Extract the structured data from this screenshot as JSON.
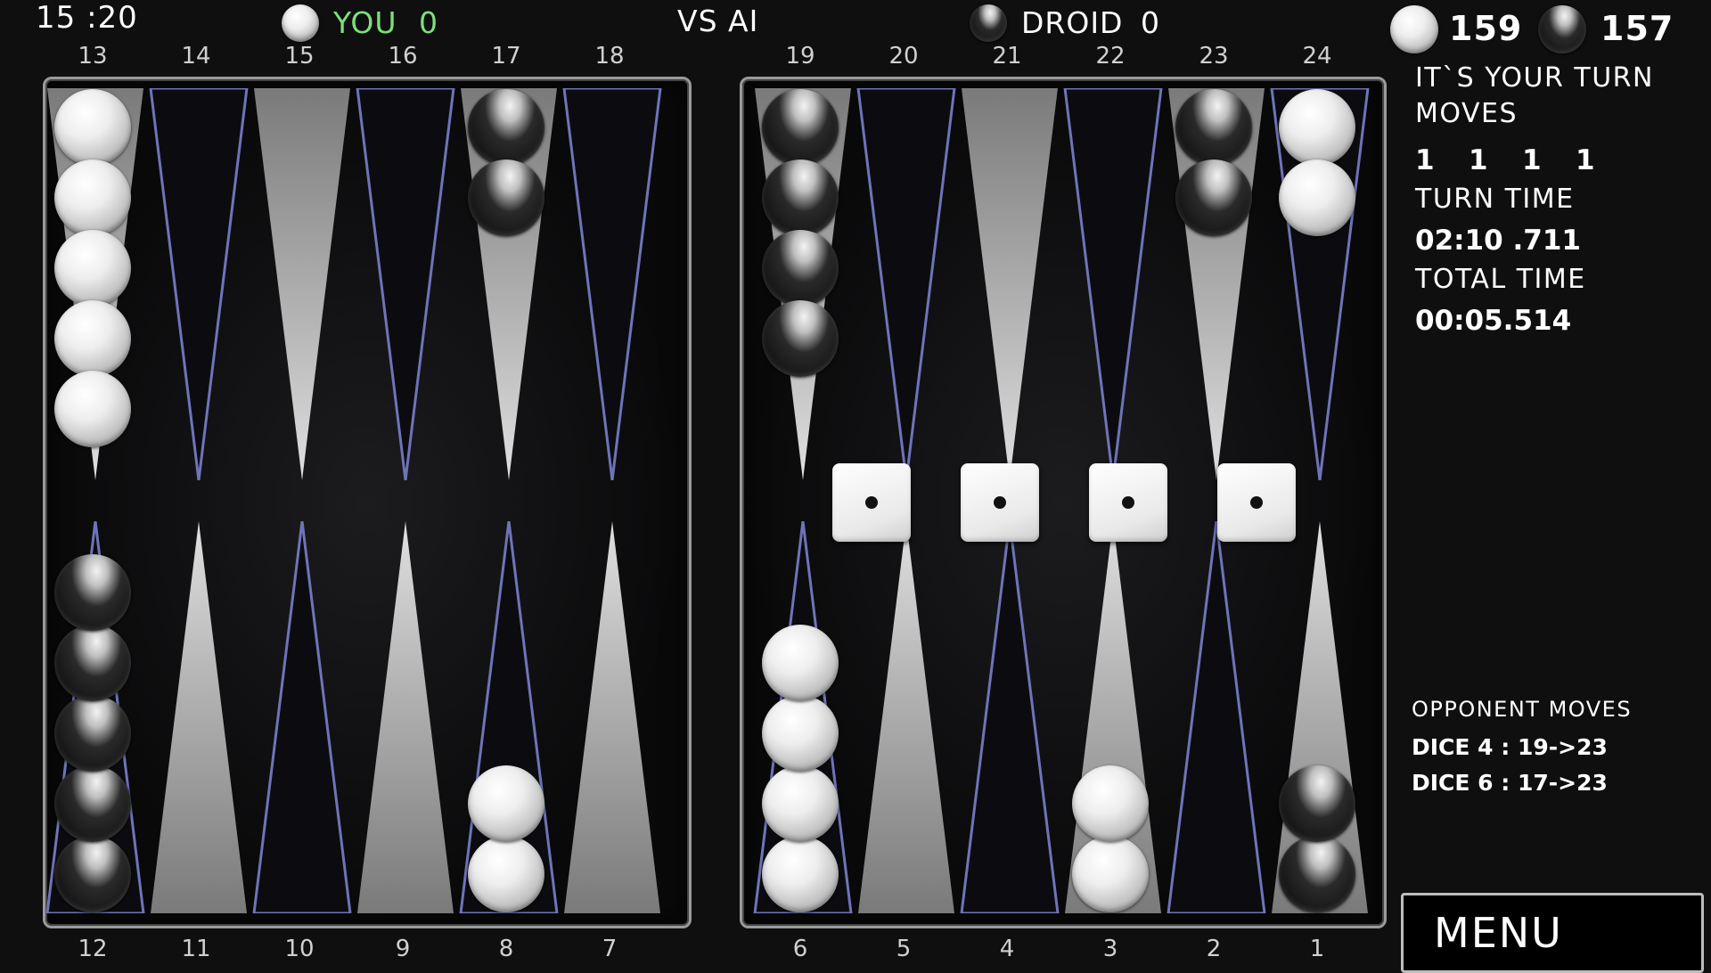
{
  "status_bar": {
    "clock": "15 :20"
  },
  "header": {
    "player_label": "YOU",
    "player_score": "0",
    "vs_label": "VS AI",
    "opponent_label": "DROID",
    "opponent_score": "0",
    "white_pip_count": "159",
    "black_pip_count": "157"
  },
  "point_numbers": {
    "top_left": [
      "13",
      "14",
      "15",
      "16",
      "17",
      "18"
    ],
    "top_right": [
      "19",
      "20",
      "21",
      "22",
      "23",
      "24"
    ],
    "bottom_left": [
      "12",
      "11",
      "10",
      "9",
      "8",
      "7"
    ],
    "bottom_right": [
      "6",
      "5",
      "4",
      "3",
      "2",
      "1"
    ]
  },
  "board": {
    "checkers": {
      "top": [
        {
          "point": "13",
          "color": "white",
          "count": 5
        },
        {
          "point": "17",
          "color": "black",
          "count": 2
        },
        {
          "point": "19",
          "color": "black",
          "count": 4
        },
        {
          "point": "23",
          "color": "black",
          "count": 2
        },
        {
          "point": "24",
          "color": "white",
          "count": 2
        }
      ],
      "bottom": [
        {
          "point": "12",
          "color": "black",
          "count": 5
        },
        {
          "point": "8",
          "color": "white",
          "count": 2
        },
        {
          "point": "6",
          "color": "white",
          "count": 4
        },
        {
          "point": "3",
          "color": "white",
          "count": 2
        },
        {
          "point": "1",
          "color": "black",
          "count": 2
        }
      ]
    },
    "dice": [
      1,
      1,
      1,
      1
    ]
  },
  "sidebar": {
    "turn_message": "IT`S YOUR TURN",
    "moves_label": "MOVES",
    "moves": [
      "1",
      "1",
      "1",
      "1"
    ],
    "turn_time_label": "TURN TIME",
    "turn_time_value": "02:10 .711",
    "total_time_label": "TOTAL TIME",
    "total_time_value": "00:05.514",
    "opponent_moves_label": "OPPONENT MOVES",
    "opponent_moves": [
      "DICE 4 : 19->23",
      "DICE 6 : 17->23"
    ],
    "menu_label": "MENU"
  },
  "colors": {
    "player_green": "#7de07a",
    "background": "#0f0f10"
  }
}
